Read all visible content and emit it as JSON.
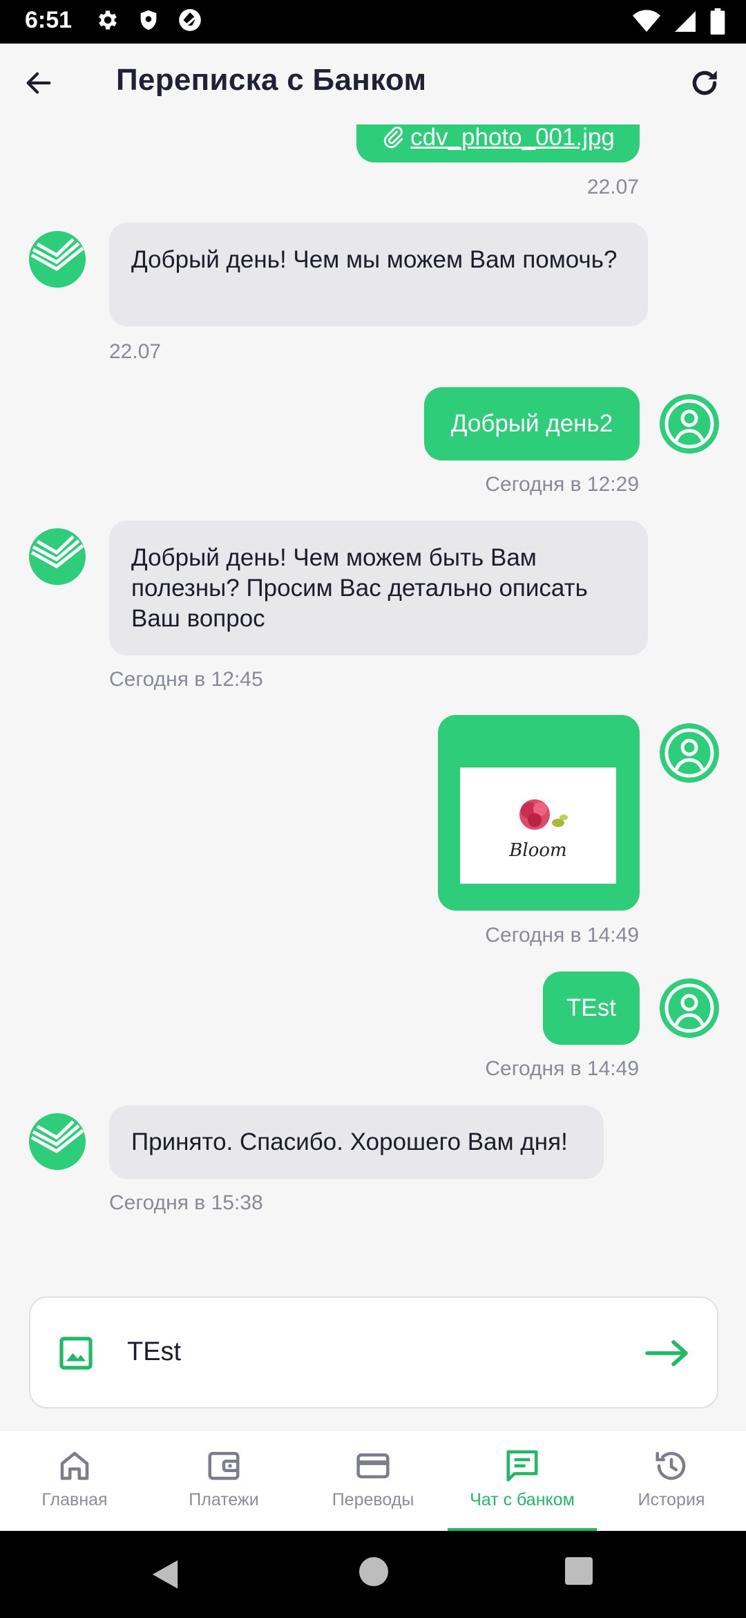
{
  "status_bar": {
    "time": "6:51"
  },
  "header": {
    "title": "Переписка с Банком"
  },
  "messages": [
    {
      "id": "m0",
      "direction": "out",
      "file_name": "cdv_photo_001.jpg",
      "time": "22.07"
    },
    {
      "id": "m1",
      "direction": "in",
      "text": "Добрый день! Чем мы можем Вам помочь?",
      "time": "22.07"
    },
    {
      "id": "m2",
      "direction": "out",
      "text": "Добрый день2",
      "time": "Сегодня в 12:29"
    },
    {
      "id": "m3",
      "direction": "in",
      "text": "Добрый день!  Чем можем быть Вам полезны?  Просим Вас детально описать Ваш вопрос",
      "time": "Сегодня в 12:45"
    },
    {
      "id": "m4",
      "direction": "out",
      "image_label": "Bloom",
      "time": "Сегодня в 14:49"
    },
    {
      "id": "m5",
      "direction": "out",
      "text": "TEst",
      "time": "Сегодня в 14:49"
    },
    {
      "id": "m6",
      "direction": "in",
      "text": "Принято. Спасибо. Хорошего Вам дня!",
      "time": "Сегодня в 15:38"
    }
  ],
  "composer": {
    "value": "TEst",
    "placeholder": ""
  },
  "nav": {
    "items": [
      {
        "label": "Главная",
        "icon": "home-icon",
        "active": false
      },
      {
        "label": "Платежи",
        "icon": "wallet-icon",
        "active": false
      },
      {
        "label": "Переводы",
        "icon": "card-icon",
        "active": false
      },
      {
        "label": "Чат с банком",
        "icon": "chat-icon",
        "active": true
      },
      {
        "label": "История",
        "icon": "history-icon",
        "active": false
      }
    ]
  },
  "colors": {
    "accent": "#2dcd79",
    "accent_text": "#21b866",
    "incoming_bubble": "#e8e8ec",
    "background": "#f6f6f7"
  }
}
